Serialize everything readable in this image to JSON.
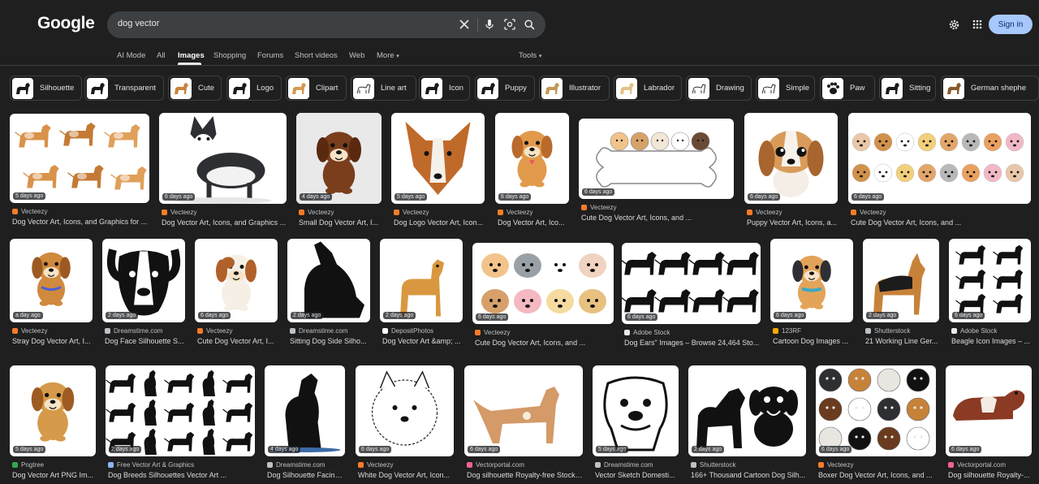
{
  "search": {
    "query": "dog vector"
  },
  "logo": "Google",
  "header": {
    "signin_label": "Sign in"
  },
  "tabs": [
    {
      "label": "AI Mode"
    },
    {
      "label": "All"
    },
    {
      "label": "Images"
    },
    {
      "label": "Shopping"
    },
    {
      "label": "Forums"
    },
    {
      "label": "Short videos"
    },
    {
      "label": "Web"
    },
    {
      "label": "More"
    }
  ],
  "tools_label": "Tools",
  "chips": [
    {
      "label": "Silhouette"
    },
    {
      "label": "Transparent"
    },
    {
      "label": "Cute"
    },
    {
      "label": "Logo"
    },
    {
      "label": "Clipart"
    },
    {
      "label": "Line art"
    },
    {
      "label": "Icon"
    },
    {
      "label": "Puppy"
    },
    {
      "label": "Illustrator"
    },
    {
      "label": "Labrador"
    },
    {
      "label": "Drawing"
    },
    {
      "label": "Simple"
    },
    {
      "label": "Paw"
    },
    {
      "label": "Sitting"
    },
    {
      "label": "German shephe"
    }
  ],
  "results": [
    {
      "badge": "5 days ago",
      "source": "Vecteezy",
      "title": "Dog Vector Art, Icons, and Graphics for ...",
      "favicon_color": "#f57c27"
    },
    {
      "badge": "6 days ago",
      "source": "Vecteezy",
      "title": "Dog Vector Art, Icons, and Graphics ...",
      "favicon_color": "#f57c27"
    },
    {
      "badge": "4 days ago",
      "source": "Vecteezy",
      "title": "Small Dog Vector Art, I...",
      "favicon_color": "#f57c27"
    },
    {
      "badge": "5 days ago",
      "source": "Vecteezy",
      "title": "Dog Logo Vector Art, Icon...",
      "favicon_color": "#f57c27"
    },
    {
      "badge": "6 days ago",
      "source": "Vecteezy",
      "title": "Dog Vector Art, Ico...",
      "favicon_color": "#f57c27"
    },
    {
      "badge": "6 days ago",
      "source": "Vecteezy",
      "title": "Cute Dog Vector Art, Icons, and ...",
      "favicon_color": "#f57c27"
    },
    {
      "badge": "6 days ago",
      "source": "Vecteezy",
      "title": "Puppy Vector Art, Icons, a...",
      "favicon_color": "#f57c27"
    },
    {
      "badge": "6 days ago",
      "source": "Vecteezy",
      "title": "Cute Dog Vector Art, Icons, and ...",
      "favicon_color": "#f57c27"
    },
    {
      "badge": "a day ago",
      "source": "Vecteezy",
      "title": "Stray Dog Vector Art, I...",
      "favicon_color": "#f57c27"
    },
    {
      "badge": "2 days ago",
      "source": "Dreamstime.com",
      "title": "Dog Face Silhouette S...",
      "favicon_color": "#bdc1c6"
    },
    {
      "badge": "6 days ago",
      "source": "Vecteezy",
      "title": "Cute Dog Vector Art, I...",
      "favicon_color": "#f57c27"
    },
    {
      "badge": "2 days ago",
      "source": "Dreamstime.com",
      "title": "Sitting Dog Side Silho...",
      "favicon_color": "#bdc1c6"
    },
    {
      "badge": "2 days ago",
      "source": "DepositPhotos",
      "title": "Dog Vector Art &amp; ...",
      "favicon_color": "#ffffff"
    },
    {
      "badge": "6 days ago",
      "source": "Vecteezy",
      "title": "Cute Dog Vector Art, Icons, and ...",
      "favicon_color": "#f57c27"
    },
    {
      "badge": "6 days ago",
      "source": "Adobe Stock",
      "title": "Dog Ears\" Images – Browse 24,464 Sto...",
      "favicon_color": "#e8eaed"
    },
    {
      "badge": "6 days ago",
      "source": "123RF",
      "title": "Cartoon Dog Images ...",
      "favicon_color": "#f9ab00"
    },
    {
      "badge": "2 days ago",
      "source": "Shutterstock",
      "title": "21 Working Line Ger...",
      "favicon_color": "#bdc1c6"
    },
    {
      "badge": "6 days ago",
      "source": "Adobe Stock",
      "title": "Beagle Icon Images – ...",
      "favicon_color": "#e8eaed"
    },
    {
      "badge": "5 days ago",
      "source": "Pngtree",
      "title": "Dog Vector Art PNG Im...",
      "favicon_color": "#34a853"
    },
    {
      "badge": "2 days ago",
      "source": "Free Vector Art & Graphics",
      "title": "Dog Breeds Silhouettes Vector Art ...",
      "favicon_color": "#8ab4f8"
    },
    {
      "badge": "4 days ago",
      "source": "Dreamstime.com",
      "title": "Dog Silhouette Facing...",
      "favicon_color": "#bdc1c6"
    },
    {
      "badge": "6 days ago",
      "source": "Vecteezy",
      "title": "White Dog Vector Art, Icon...",
      "favicon_color": "#f57c27"
    },
    {
      "badge": "6 days ago",
      "source": "Vectorportal.com",
      "title": "Dog silhouette Royalty-free Stock ...",
      "favicon_color": "#f06292"
    },
    {
      "badge": "5 days ago",
      "source": "Dreamstime.com",
      "title": "Vector Sketch Domesti...",
      "favicon_color": "#bdc1c6"
    },
    {
      "badge": "2 days ago",
      "source": "Shutterstock",
      "title": "166+ Thousand Cartoon Dog Silh...",
      "favicon_color": "#bdc1c6"
    },
    {
      "badge": "6 days ago",
      "source": "Vecteezy",
      "title": "Boxer Dog Vector Art, Icons, and ...",
      "favicon_color": "#f57c27"
    },
    {
      "badge": "6 days ago",
      "source": "Vectorportal.com",
      "title": "Dog silhouette Royalty-...",
      "favicon_color": "#f06292"
    }
  ]
}
